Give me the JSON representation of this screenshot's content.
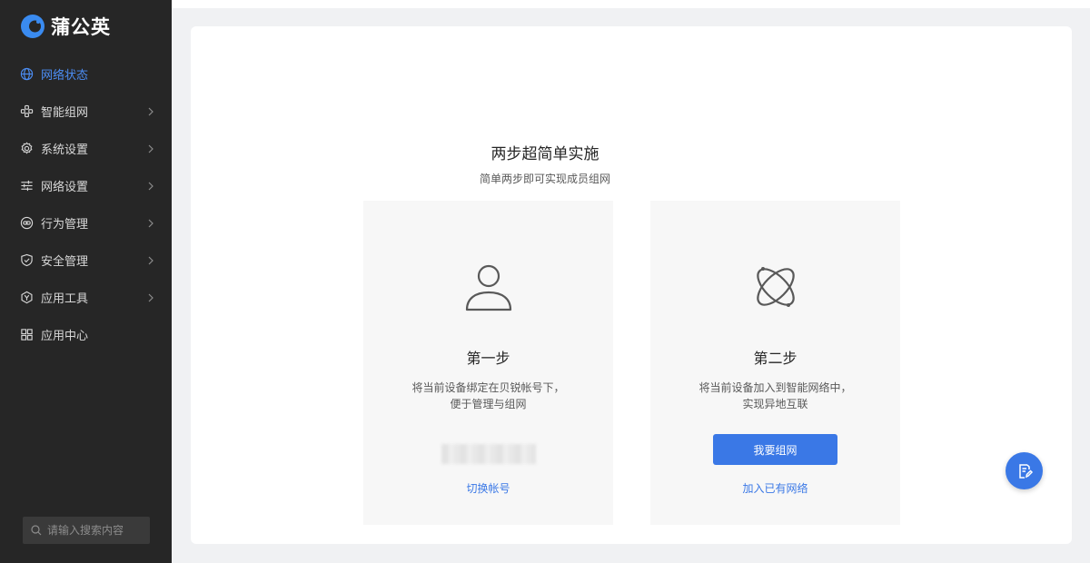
{
  "app": {
    "logo_text": "蒲公英"
  },
  "sidebar": {
    "items": [
      {
        "label": "网络状态",
        "icon": "globe-icon",
        "active": true,
        "has_submenu": false
      },
      {
        "label": "智能组网",
        "icon": "network-icon",
        "active": false,
        "has_submenu": true
      },
      {
        "label": "系统设置",
        "icon": "gear-icon",
        "active": false,
        "has_submenu": true
      },
      {
        "label": "网络设置",
        "icon": "sliders-icon",
        "active": false,
        "has_submenu": true
      },
      {
        "label": "行为管理",
        "icon": "link-icon",
        "active": false,
        "has_submenu": true
      },
      {
        "label": "安全管理",
        "icon": "shield-icon",
        "active": false,
        "has_submenu": true
      },
      {
        "label": "应用工具",
        "icon": "tools-icon",
        "active": false,
        "has_submenu": true
      },
      {
        "label": "应用中心",
        "icon": "grid-icon",
        "active": false,
        "has_submenu": false
      }
    ],
    "search": {
      "placeholder": "请输入搜索内容",
      "value": ""
    }
  },
  "main": {
    "title": "两步超简单实施",
    "subtitle": "简单两步即可实现成员组网",
    "steps": [
      {
        "title": "第一步",
        "desc_line1": "将当前设备绑定在贝锐帐号下，",
        "desc_line2": "便于管理与组网",
        "icon": "user-icon",
        "link_label": "切换帐号"
      },
      {
        "title": "第二步",
        "desc_line1": "将当前设备加入到智能网络中，",
        "desc_line2": "实现异地互联",
        "icon": "atom-icon",
        "button_label": "我要组网",
        "link_label": "加入已有网络"
      }
    ]
  },
  "colors": {
    "sidebar_bg": "#262626",
    "accent": "#3a78e6",
    "active_nav": "#4c8ef5"
  },
  "fab": {
    "icon": "document-edit-icon"
  }
}
